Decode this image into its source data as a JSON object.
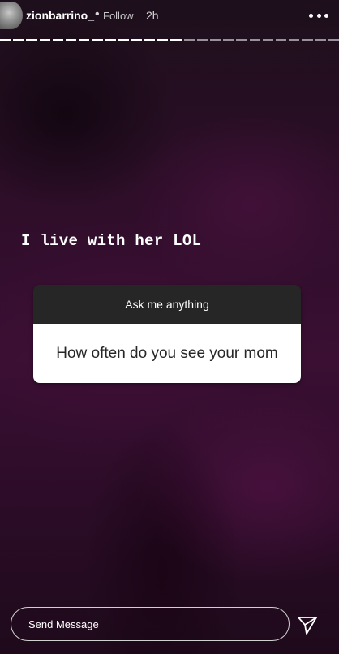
{
  "header": {
    "username": "zionbarrino_",
    "separator": "•",
    "follow_label": "Follow",
    "time_ago": "2h",
    "more_icon": "more-dots-icon"
  },
  "progress": {
    "segments_total": 26,
    "segments_done": 14
  },
  "story": {
    "caption": "I live with her LOL",
    "question_card": {
      "prompt": "Ask me anything",
      "question": "How often do you see your mom"
    }
  },
  "footer": {
    "send_placeholder": "Send Message",
    "send_icon": "paper-plane-icon"
  },
  "colors": {
    "background": "#2e0e29",
    "card_header": "#262626",
    "card_body": "#ffffff"
  }
}
